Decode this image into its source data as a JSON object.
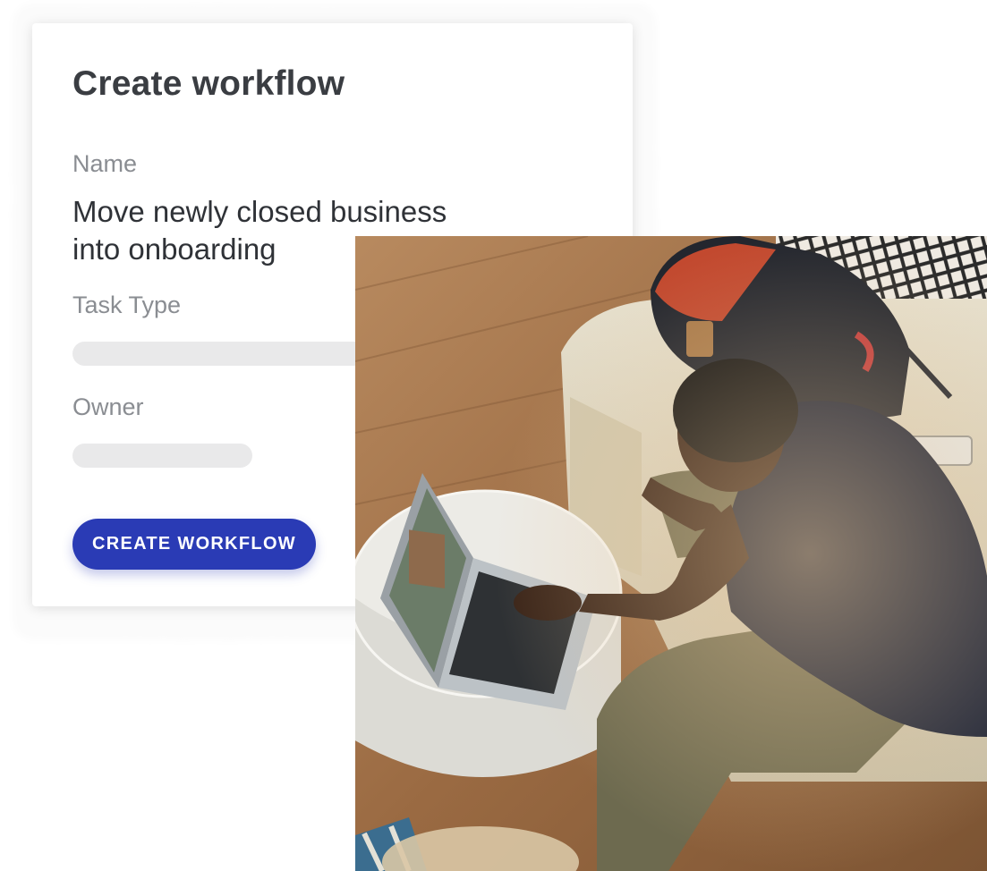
{
  "card": {
    "title": "Create workflow",
    "fields": [
      {
        "label": "Name",
        "value": "Move newly closed business into onboarding"
      },
      {
        "label": "Task Type",
        "value": ""
      },
      {
        "label": "Owner",
        "value": ""
      }
    ],
    "button_label": "CREATE WORKFLOW"
  },
  "colors": {
    "accent": "#2a3bb5",
    "title_text": "#3a3d42",
    "label_text": "#8a8d92",
    "skeleton": "#e9e9ea"
  },
  "photo": {
    "subject": "photo-person-with-laptop"
  }
}
